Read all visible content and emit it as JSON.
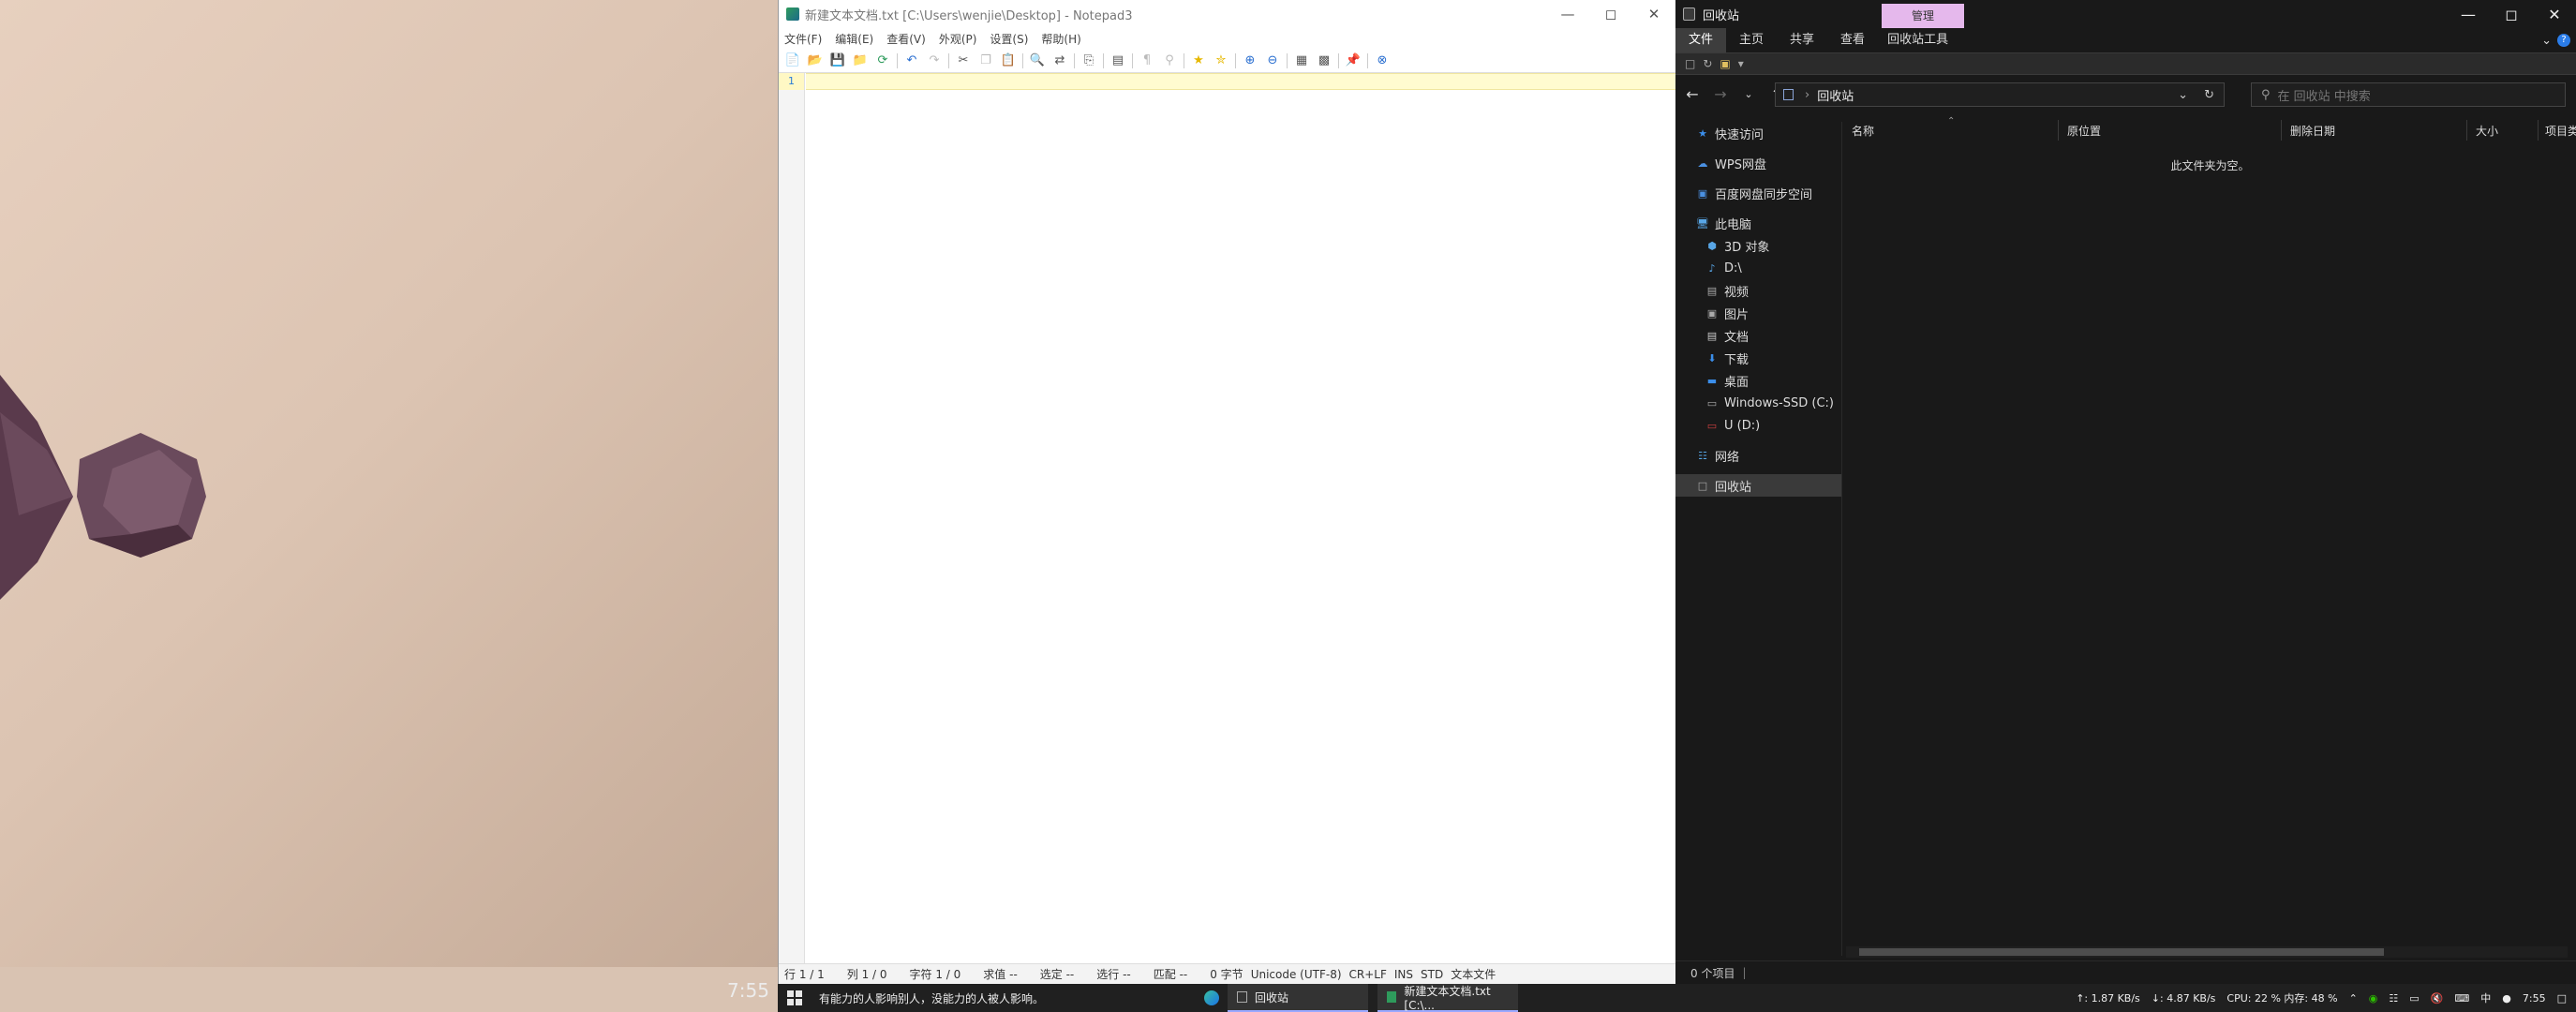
{
  "desktop": {
    "clock": "7:55"
  },
  "notepad": {
    "title": "新建文本文档.txt [C:\\Users\\wenjie\\Desktop] - Notepad3",
    "menu": [
      "文件(F)",
      "编辑(E)",
      "查看(V)",
      "外观(P)",
      "设置(S)",
      "帮助(H)"
    ],
    "line_number": "1",
    "status": {
      "row": "行  1 / 1",
      "col": "列  1 / 0",
      "char": "字符  1 / 0",
      "eval": "求值  --",
      "sel": "选定  --",
      "selline": "选行  --",
      "match": "匹配  --",
      "bytes": "0 字节",
      "encoding": "Unicode (UTF-8)",
      "eol": "CR+LF",
      "ins": "INS",
      "std": "STD",
      "type": "文本文件"
    }
  },
  "explorer": {
    "title": "回收站",
    "manage": "管理",
    "ribbon_tabs": [
      "文件",
      "主页",
      "共享",
      "查看",
      "回收站工具"
    ],
    "address": "回收站",
    "search_placeholder": "在 回收站 中搜索",
    "sidebar": {
      "quick_access": "快速访问",
      "wps": "WPS网盘",
      "baidu": "百度网盘同步空间",
      "this_pc": "此电脑",
      "obj3d": "3D 对象",
      "d_drive": "D:\\",
      "video": "视频",
      "pictures": "图片",
      "docs": "文档",
      "downloads": "下载",
      "desktop": "桌面",
      "c_drive": "Windows-SSD (C:)",
      "u_drive": "U (D:)",
      "network": "网络",
      "recycle": "回收站"
    },
    "columns": [
      "名称",
      "原位置",
      "删除日期",
      "大小",
      "项目类型"
    ],
    "empty_text": "此文件夹为空。",
    "status": "0 个项目"
  },
  "taskbar": {
    "message": "有能力的人影响别人，没能力的人被人影响。",
    "explorer_app": "回收站",
    "notepad_app": "新建文本文档.txt [C:\\...",
    "upload": "↑: 1.87 KB/s",
    "download": "↓: 4.87 KB/s",
    "cpu": "CPU: 22 % 内存: 48 %",
    "ime": "中",
    "time": "7:55"
  }
}
